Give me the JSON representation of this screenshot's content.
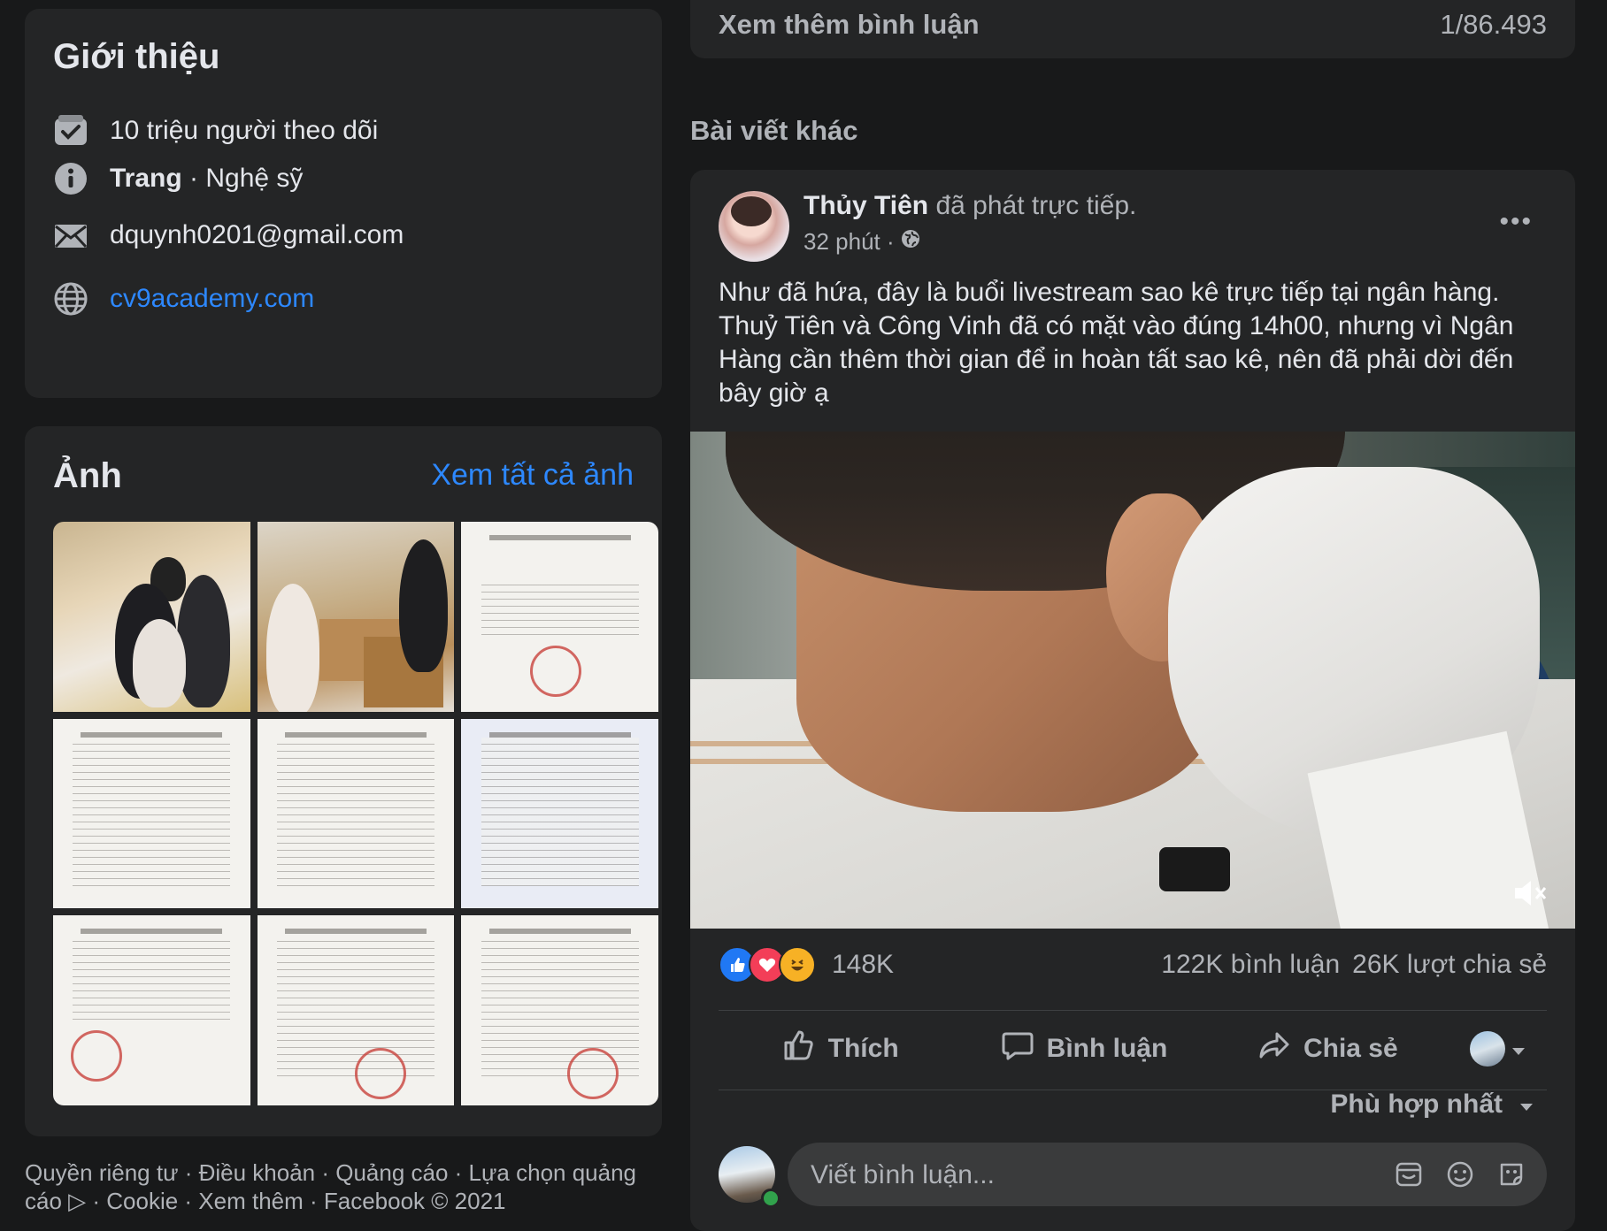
{
  "intro": {
    "title": "Giới thiệu",
    "followers": "10 triệu người theo dõi",
    "page_type": "Trang",
    "page_category": " · Nghệ sỹ",
    "email": "dquynh0201@gmail.com",
    "website": "cv9academy.com"
  },
  "photos": {
    "title": "Ảnh",
    "see_all": "Xem tất cả ảnh"
  },
  "footer": {
    "text": "Quyền riêng tư · Điều khoản · Quảng cáo · Lựa chọn quảng cáo ▷ · Cookie · Xem thêm · Facebook © 2021"
  },
  "comments_bar": {
    "more": "Xem thêm bình luận",
    "count": "1/86.493"
  },
  "other_posts_heading": "Bài viết khác",
  "post": {
    "author": "Thủy Tiên",
    "action": " đã phát trực tiếp.",
    "time": "32 phút ·",
    "text": "Như đã hứa, đây là buổi livestream sao kê trực tiếp tại ngân hàng. Thuỷ Tiên và Công Vinh đã có mặt vào đúng 14h00, nhưng vì Ngân Hàng cần thêm thời gian để in hoàn tất sao kê, nên đã phải dời đến bây giờ ạ",
    "reactions_count": "148K",
    "comments_count": "122K bình luận",
    "shares_count": "26K lượt chia sẻ",
    "like_label": "Thích",
    "comment_label": "Bình luận",
    "share_label": "Chia sẻ",
    "sort_label": "Phù hợp nhất",
    "comment_placeholder": "Viết bình luận..."
  },
  "colors": {
    "background": "#18191a",
    "card": "#242526",
    "link": "#2d88ff",
    "like": "#2078f4",
    "love": "#f33e58",
    "haha": "#f7b125"
  }
}
